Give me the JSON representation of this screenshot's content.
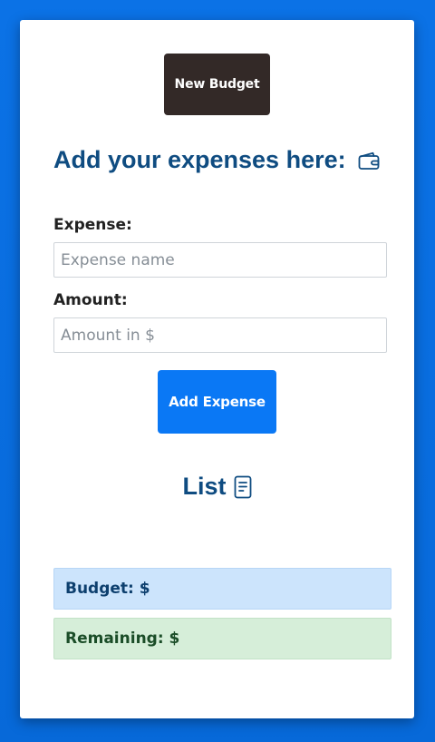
{
  "app": {
    "new_budget_label": "New Budget",
    "heading": "Add your expenses here:",
    "heading_icon": "wallet-icon"
  },
  "form": {
    "expense_label": "Expense:",
    "expense_value": "",
    "expense_placeholder": "Expense name",
    "amount_label": "Amount:",
    "amount_value": "",
    "amount_placeholder": "Amount in $",
    "add_button_label": "Add Expense"
  },
  "list": {
    "title": "List",
    "title_icon": "document-list-icon",
    "items": []
  },
  "summary": {
    "budget_text": "Budget: $",
    "remaining_text": "Remaining: $"
  },
  "colors": {
    "page_background": "#0a6fe0",
    "card_background": "#ffffff",
    "new_budget_button": "#332927",
    "add_button": "#0a78f5",
    "heading": "#0f4c81",
    "budget_alert_bg": "#cce4fc",
    "remaining_alert_bg": "#d6eed9"
  }
}
